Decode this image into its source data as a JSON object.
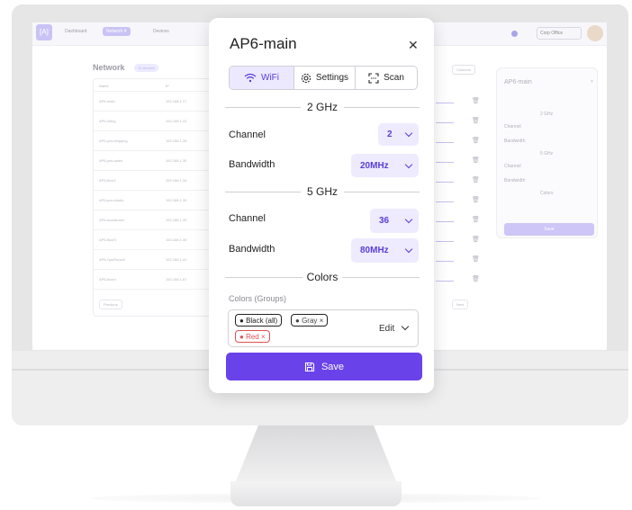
{
  "app": {
    "nav": [
      "Dashboard",
      "Network",
      "Devices"
    ],
    "network_badge": "4",
    "org_select": "Corp Office",
    "page_title": "Network",
    "page_badge": "11 devices",
    "table_headers": [
      "Name",
      "IP"
    ],
    "rows": [
      {
        "name": "AP6-main",
        "ip": "192.168.1.17"
      },
      {
        "name": "AP6-lobby",
        "ip": "192.168.1.22"
      },
      {
        "name": "AP6-pos-shipping",
        "ip": "192.168.1.28"
      },
      {
        "name": "AP6-pos-sales",
        "ip": "192.168.1.30"
      },
      {
        "name": "AP6-floor2",
        "ip": "192.168.1.34"
      },
      {
        "name": "AP6-pos-studio",
        "ip": "192.168.1.39"
      },
      {
        "name": "AP6-boardroom",
        "ip": "192.168.1.40"
      },
      {
        "name": "AP6-floor3",
        "ip": "192.168.1.40"
      },
      {
        "name": "AP6-OpsRoom2",
        "ip": "192.168.1.41"
      },
      {
        "name": "AP6-floor4",
        "ip": "192.168.1.67"
      }
    ],
    "prev_label": "Previous",
    "next_label": "Next",
    "filter_label": "Columns"
  },
  "modal": {
    "title": "AP6-main",
    "tabs": [
      {
        "label": "WiFi",
        "icon": "wifi-icon",
        "active": true
      },
      {
        "label": "Settings",
        "icon": "gear-icon",
        "active": false
      },
      {
        "label": "Scan",
        "icon": "scan-icon",
        "active": false
      }
    ],
    "band_24": {
      "heading": "2 GHz",
      "channel_label": "Channel",
      "channel_value": "2",
      "bandwidth_label": "Bandwidth",
      "bandwidth_value": "20MHz"
    },
    "band_5": {
      "heading": "5 GHz",
      "channel_label": "Channel",
      "channel_value": "36",
      "bandwidth_label": "Bandwidth",
      "bandwidth_value": "80MHz"
    },
    "colors": {
      "heading": "Colors",
      "groups_label": "Colors (Groups)",
      "chips": [
        "Black (all)",
        "Gray",
        "Red"
      ],
      "edit_label": "Edit"
    },
    "save_label": "Save"
  },
  "theme": {
    "accent": "#6a42ea",
    "accent_light": "#eeebff",
    "danger": "#e05050"
  }
}
